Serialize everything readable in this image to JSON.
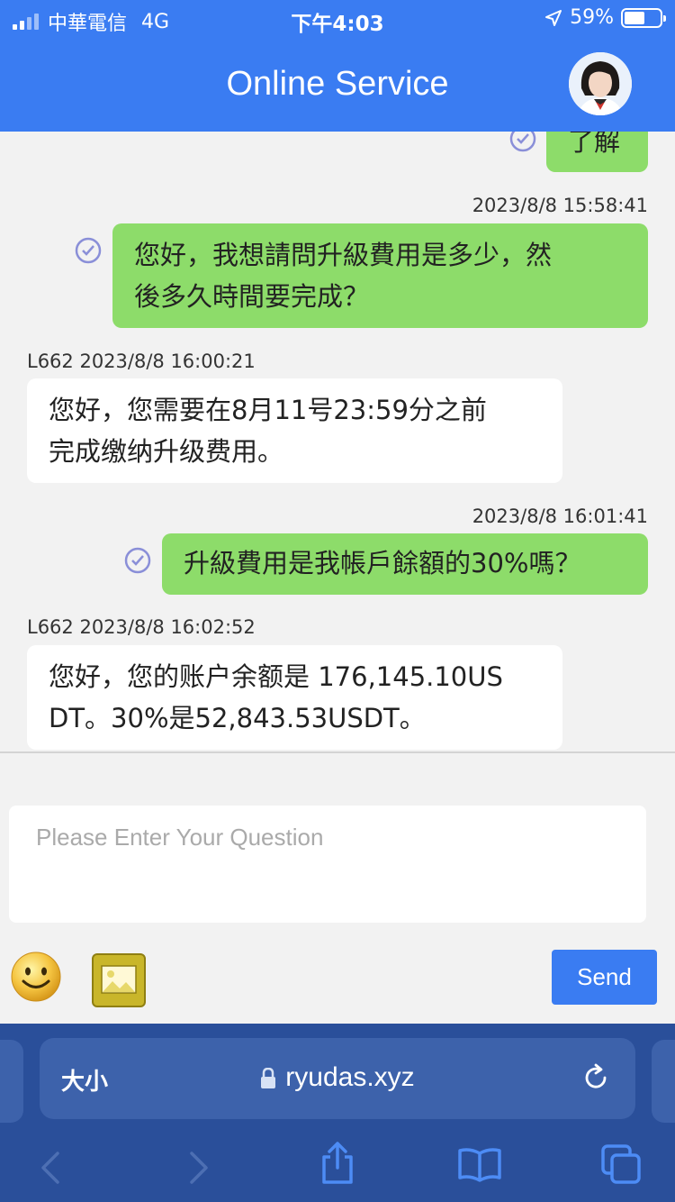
{
  "status_bar": {
    "carrier": "中華電信",
    "network": "4G",
    "time": "下午4:03",
    "battery": "59%"
  },
  "header": {
    "title": "Online Service"
  },
  "messages": [
    {
      "direction": "out",
      "text": "了解"
    },
    {
      "direction": "out",
      "time": "2023/8/8 15:58:41",
      "text_lines": [
        "您好，我想請問升級費用是多少，然",
        "後多久時間要完成？"
      ]
    },
    {
      "direction": "in",
      "sender_time": "L662 2023/8/8 16:00:21",
      "text_lines": [
        "您好，您需要在8月11号23:59分之前",
        "完成缴纳升级费用。"
      ]
    },
    {
      "direction": "out",
      "time": "2023/8/8 16:01:41",
      "text": "升級費用是我帳戶餘額的30%嗎？"
    },
    {
      "direction": "in",
      "sender_time": "L662 2023/8/8 16:02:52",
      "text_lines": [
        "您好，您的账户余额是 176,145.10US",
        "DT。30%是52,843.53USDT。"
      ]
    }
  ],
  "composer": {
    "placeholder": "Please Enter Your Question",
    "send_label": "Send"
  },
  "browser": {
    "text_size_label": "大小",
    "url": "ryudas.xyz"
  },
  "colors": {
    "accent": "#3a7cf2",
    "outgoing_bubble": "#8ddc6a",
    "browser_bar": "#2a4f9a"
  }
}
